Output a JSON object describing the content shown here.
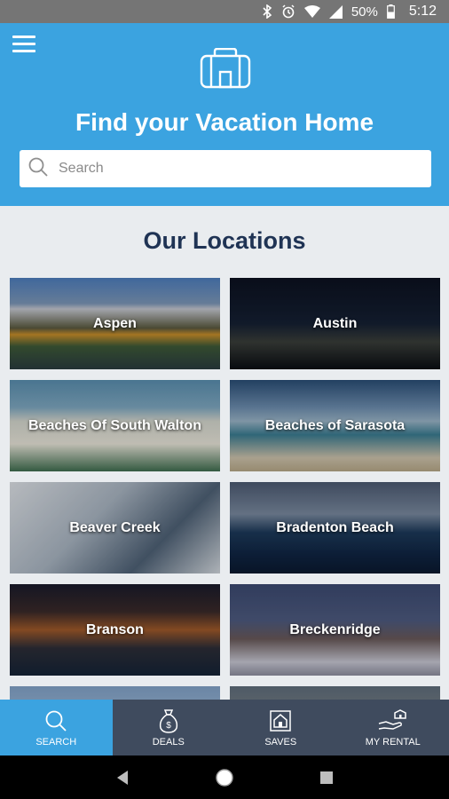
{
  "status_bar": {
    "battery": "50%",
    "time": "5:12",
    "icons": [
      "bluetooth-icon",
      "alarm-icon",
      "wifi-icon",
      "signal-icon",
      "battery-icon"
    ]
  },
  "header": {
    "title": "Find your Vacation Home",
    "search_placeholder": "Search",
    "search_value": "",
    "menu_icon": "hamburger-menu-icon",
    "logo_icon": "suitcase-logo-icon"
  },
  "locations": {
    "title": "Our Locations",
    "items": [
      {
        "label": "Aspen"
      },
      {
        "label": "Austin"
      },
      {
        "label": "Beaches Of South Walton"
      },
      {
        "label": "Beaches of Sarasota"
      },
      {
        "label": "Beaver Creek"
      },
      {
        "label": "Bradenton Beach"
      },
      {
        "label": "Branson"
      },
      {
        "label": "Breckenridge"
      }
    ]
  },
  "bottom_nav": {
    "items": [
      {
        "label": "SEARCH",
        "icon": "search-icon",
        "active": true
      },
      {
        "label": "DEALS",
        "icon": "money-bag-icon",
        "active": false
      },
      {
        "label": "SAVES",
        "icon": "saved-home-icon",
        "active": false
      },
      {
        "label": "MY RENTAL",
        "icon": "hand-home-icon",
        "active": false
      }
    ]
  },
  "colors": {
    "header_bg": "#3ba3e0",
    "page_bg": "#e9ecef",
    "title_navy": "#1f3354",
    "nav_bg": "#3f4b5e",
    "nav_active": "#3ba3e0"
  }
}
